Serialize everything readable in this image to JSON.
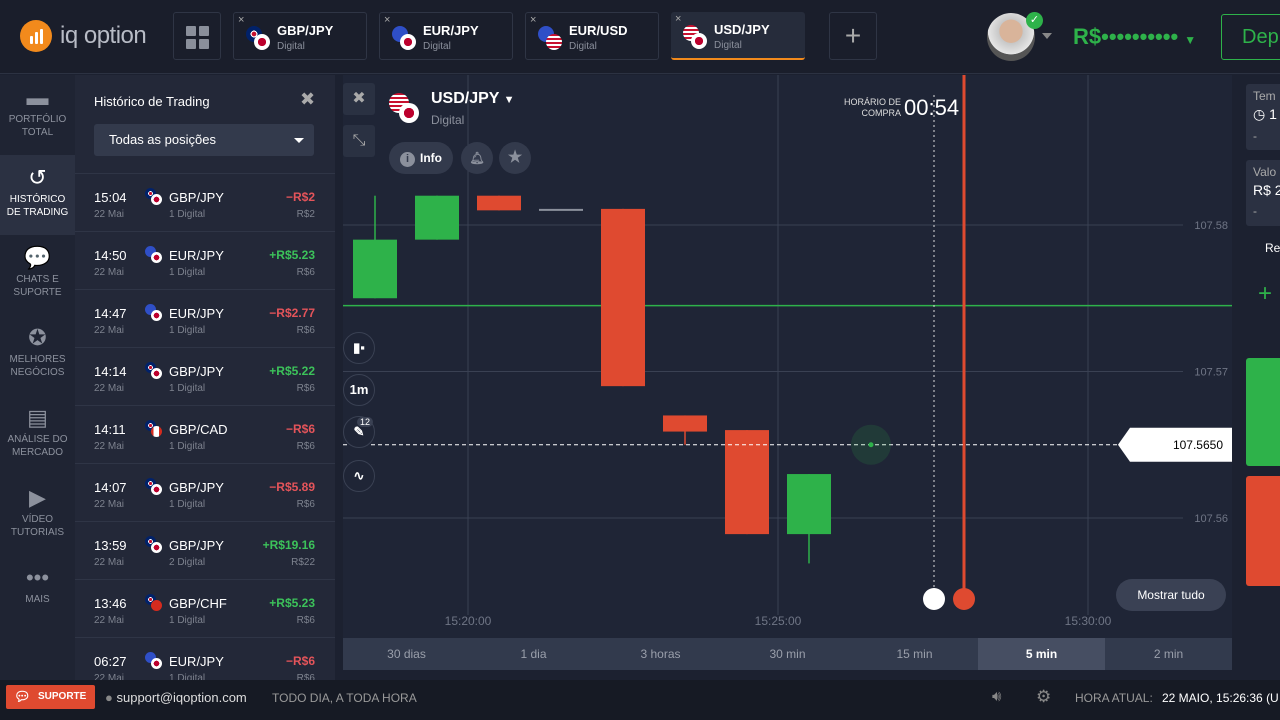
{
  "header": {
    "logo_text": "iq option",
    "tabs": [
      {
        "pair": "GBP/JPY",
        "type": "Digital",
        "f1": "gb",
        "f2": "jp"
      },
      {
        "pair": "EUR/JPY",
        "type": "Digital",
        "f1": "eu",
        "f2": "jp"
      },
      {
        "pair": "EUR/USD",
        "type": "Digital",
        "f1": "eu",
        "f2": "us"
      },
      {
        "pair": "USD/JPY",
        "type": "Digital",
        "f1": "us",
        "f2": "jp",
        "active": true
      }
    ],
    "close": "×",
    "add": "+",
    "balance": "R$••••••••••",
    "deposit": "Dep"
  },
  "sidebar": [
    {
      "icon": "briefcase-icon",
      "glyph": "▬",
      "label": "PORTFÓLIO TOTAL"
    },
    {
      "icon": "history-icon",
      "glyph": "↺",
      "label": "HISTÓRICO DE TRADING",
      "active": true
    },
    {
      "icon": "chat-icon",
      "glyph": "💬",
      "label": "CHATS E SUPORTE"
    },
    {
      "icon": "medal-icon",
      "glyph": "✪",
      "label": "MELHORES NEGÓCIOS"
    },
    {
      "icon": "news-icon",
      "glyph": "▤",
      "label": "ANÁLISE DO MERCADO"
    },
    {
      "icon": "play-icon",
      "glyph": "▶",
      "label": "VÍDEO TUTORIAIS"
    },
    {
      "icon": "more-icon",
      "glyph": "•••",
      "label": "MAIS"
    }
  ],
  "history": {
    "title": "Histórico de Trading",
    "close": "✖",
    "filter": "Todas as posições",
    "rows": [
      {
        "time": "15:04",
        "date": "22 Mai",
        "pair": "GBP/JPY",
        "kind": "1 Digital",
        "pl": "−R$2",
        "inv": "R$2",
        "f1": "gb",
        "f2": "jp",
        "neg": true
      },
      {
        "time": "14:50",
        "date": "22 Mai",
        "pair": "EUR/JPY",
        "kind": "1 Digital",
        "pl": "+R$5.23",
        "inv": "R$6",
        "f1": "eu",
        "f2": "jp"
      },
      {
        "time": "14:47",
        "date": "22 Mai",
        "pair": "EUR/JPY",
        "kind": "1 Digital",
        "pl": "−R$2.77",
        "inv": "R$6",
        "f1": "eu",
        "f2": "jp",
        "neg": true
      },
      {
        "time": "14:14",
        "date": "22 Mai",
        "pair": "GBP/JPY",
        "kind": "1 Digital",
        "pl": "+R$5.22",
        "inv": "R$6",
        "f1": "gb",
        "f2": "jp"
      },
      {
        "time": "14:11",
        "date": "22 Mai",
        "pair": "GBP/CAD",
        "kind": "1 Digital",
        "pl": "−R$6",
        "inv": "R$6",
        "f1": "gb",
        "f2": "ca",
        "neg": true
      },
      {
        "time": "14:07",
        "date": "22 Mai",
        "pair": "GBP/JPY",
        "kind": "1 Digital",
        "pl": "−R$5.89",
        "inv": "R$6",
        "f1": "gb",
        "f2": "jp",
        "neg": true
      },
      {
        "time": "13:59",
        "date": "22 Mai",
        "pair": "GBP/JPY",
        "kind": "2 Digital",
        "pl": "+R$19.16",
        "inv": "R$22",
        "f1": "gb",
        "f2": "jp"
      },
      {
        "time": "13:46",
        "date": "22 Mai",
        "pair": "GBP/CHF",
        "kind": "1 Digital",
        "pl": "+R$5.23",
        "inv": "R$6",
        "f1": "gb",
        "f2": "ch"
      },
      {
        "time": "06:27",
        "date": "22 Mai",
        "pair": "EUR/JPY",
        "kind": "1 Digital",
        "pl": "−R$6",
        "inv": "R$6",
        "f1": "eu",
        "f2": "jp",
        "neg": true
      }
    ]
  },
  "chart_header": {
    "pair": "USD/JPY",
    "type": "Digital",
    "info": "Info",
    "buy_time_label": "HORÁRIO DE COMPRA",
    "buy_time": "00:54",
    "indicator_count": "12",
    "timeframe": "1m",
    "show_all": "Mostrar tudo"
  },
  "chart_data": {
    "type": "candlestick",
    "ylim": [
      107.555,
      107.586
    ],
    "yticks": [
      "107.58",
      "107.57",
      "107.56"
    ],
    "xticks": [
      "15:20:00",
      "15:25:00",
      "15:30:00"
    ],
    "current_price": "107.5650",
    "green_level": 107.5745,
    "candles": [
      {
        "t": "15:18",
        "o": 107.575,
        "h": 107.582,
        "l": 107.575,
        "c": 107.579
      },
      {
        "t": "15:19",
        "o": 107.579,
        "h": 107.582,
        "l": 107.579,
        "c": 107.582
      },
      {
        "t": "15:20",
        "o": 107.582,
        "h": 107.582,
        "l": 107.581,
        "c": 107.581
      },
      {
        "t": "15:21",
        "o": 107.5811,
        "h": 107.5811,
        "l": 107.5811,
        "c": 107.5811
      },
      {
        "t": "15:22",
        "o": 107.5811,
        "h": 107.5811,
        "l": 107.569,
        "c": 107.569
      },
      {
        "t": "15:23",
        "o": 107.567,
        "h": 107.567,
        "l": 107.565,
        "c": 107.5659
      },
      {
        "t": "15:24",
        "o": 107.566,
        "h": 107.566,
        "l": 107.5589,
        "c": 107.5589
      },
      {
        "t": "15:25",
        "o": 107.5589,
        "h": 107.563,
        "l": 107.5569,
        "c": 107.563
      }
    ]
  },
  "periods": [
    {
      "label": "30 dias"
    },
    {
      "label": "1 dia"
    },
    {
      "label": "3 horas"
    },
    {
      "label": "30 min"
    },
    {
      "label": "15 min"
    },
    {
      "label": "5 min",
      "sel": true
    },
    {
      "label": "2 min"
    }
  ],
  "right_panel": {
    "time_label": "Tem",
    "time_value": "1",
    "amount_label": "Valo",
    "amount_value": "R$ 2",
    "minus": "-",
    "profit_label": "Re",
    "profit_sign": "+"
  },
  "footer": {
    "support": "SUPORTE",
    "email": "support@iqoption.com",
    "hours": "TODO DIA, A TODA HORA",
    "time_label": "HORA ATUAL:",
    "time_value": "22 MAIO, 15:26:36 (U"
  }
}
